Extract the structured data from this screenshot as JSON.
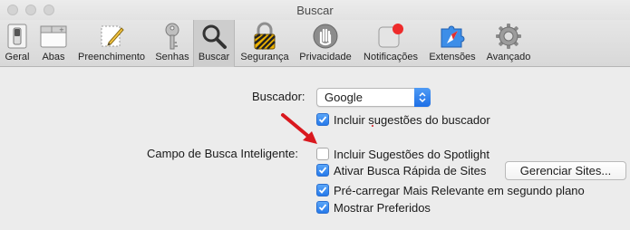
{
  "window": {
    "title": "Buscar"
  },
  "toolbar": {
    "items": [
      {
        "label": "Geral",
        "icon": "general-switch-icon"
      },
      {
        "label": "Abas",
        "icon": "tabs-icon"
      },
      {
        "label": "Preenchimento",
        "icon": "autofill-pencil-icon"
      },
      {
        "label": "Senhas",
        "icon": "key-icon"
      },
      {
        "label": "Buscar",
        "icon": "magnifier-icon"
      },
      {
        "label": "Segurança",
        "icon": "lock-icon"
      },
      {
        "label": "Privacidade",
        "icon": "hand-icon"
      },
      {
        "label": "Notificações",
        "icon": "notification-badge-icon"
      },
      {
        "label": "Extensões",
        "icon": "extensions-compass-icon"
      },
      {
        "label": "Avançado",
        "icon": "gear-icon"
      }
    ],
    "active": "Buscar"
  },
  "search": {
    "engine_label": "Buscador:",
    "engine_value": "Google",
    "include_suggestions": {
      "label": "Incluir sugestões do buscador",
      "checked": true
    },
    "smart_field_label": "Campo de Busca Inteligente:",
    "spotlight": {
      "label": "Incluir Sugestões do Spotlight",
      "checked": false
    },
    "quick_search": {
      "label": "Ativar Busca Rápida de Sites",
      "checked": true
    },
    "manage_sites_button": "Gerenciar Sites...",
    "preload": {
      "label": "Pré-carregar Mais Relevante em segundo plano",
      "checked": true
    },
    "favorites": {
      "label": "Mostrar Preferidos",
      "checked": true
    }
  },
  "colors": {
    "accent": "#2679ea",
    "arrow": "#d9181e"
  }
}
